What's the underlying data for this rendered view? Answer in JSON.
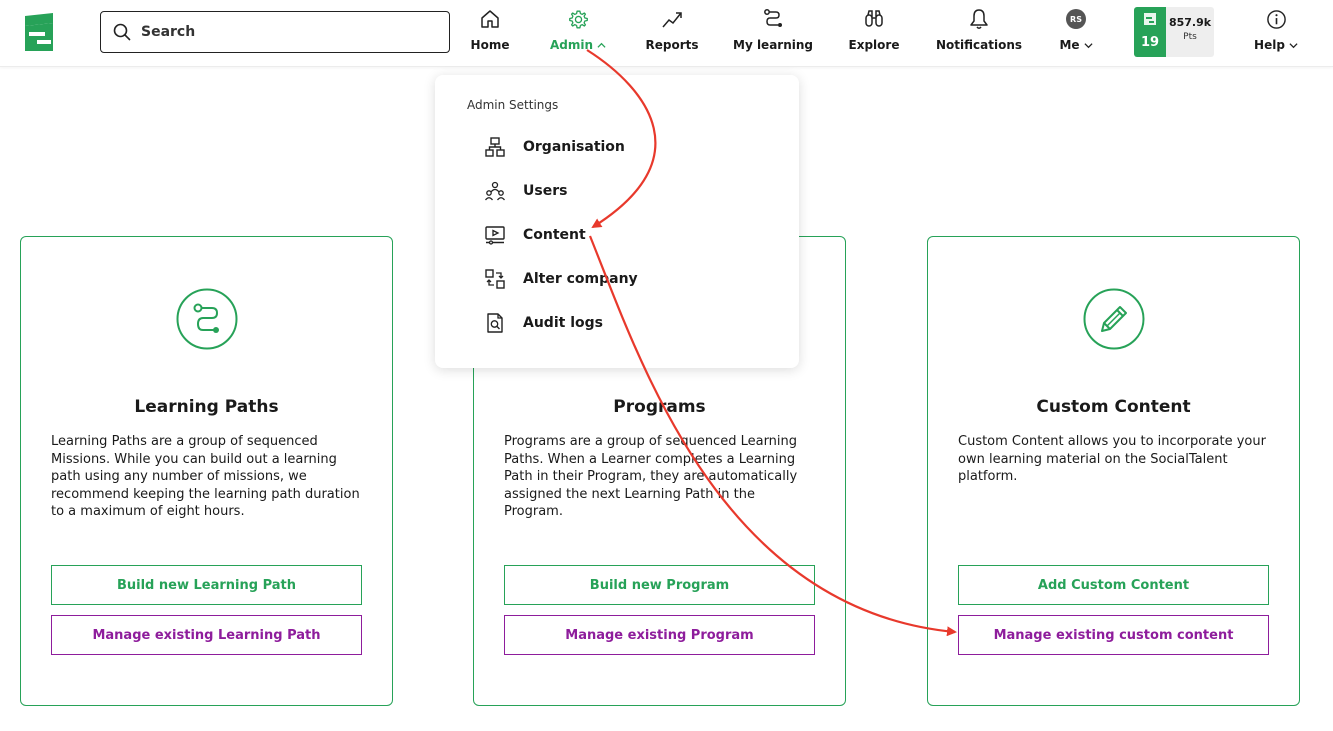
{
  "colors": {
    "brand_green": "#27a258",
    "manage_purple": "#8e1d9c",
    "annotation_red": "#e8392c"
  },
  "header": {
    "logo": "socialtalent-logo-icon",
    "search": {
      "placeholder": "Search"
    },
    "nav": [
      {
        "label": "Home",
        "icon": "home-icon"
      },
      {
        "label": "Admin",
        "icon": "gear-icon",
        "active": true
      },
      {
        "label": "Reports",
        "icon": "trend-up-icon"
      },
      {
        "label": "My learning",
        "icon": "learning-path-icon"
      },
      {
        "label": "Explore",
        "icon": "binoculars-icon"
      },
      {
        "label": "Notifications",
        "icon": "bell-icon"
      },
      {
        "label": "Me",
        "avatar_initials": "RS"
      },
      {
        "label": "Help",
        "icon": "info-icon"
      }
    ],
    "points": {
      "level": "19",
      "value": "857.9k",
      "unit": "Pts"
    }
  },
  "admin_menu": {
    "heading": "Admin Settings",
    "items": [
      {
        "label": "Organisation",
        "icon": "org-chart-icon"
      },
      {
        "label": "Users",
        "icon": "users-icon"
      },
      {
        "label": "Content",
        "icon": "content-player-icon"
      },
      {
        "label": "Alter company",
        "icon": "switch-company-icon"
      },
      {
        "label": "Audit logs",
        "icon": "audit-log-icon"
      }
    ]
  },
  "cards": [
    {
      "title": "Learning Paths",
      "icon": "learning-path-icon",
      "description": "Learning Paths are a group of sequenced Missions. While you can build out a learning path using any number of missions, we recommend keeping the learning path duration to a maximum of eight hours.",
      "primary_button": "Build new Learning Path",
      "secondary_button": "Manage existing Learning Path"
    },
    {
      "title": "Programs",
      "icon": "programs-icon",
      "description": "Programs are a group of sequenced Learning Paths. When a Learner completes a Learning Path in their Program, they are automatically assigned the next Learning Path in the Program.",
      "primary_button": "Build new Program",
      "secondary_button": "Manage existing Program"
    },
    {
      "title": "Custom Content",
      "icon": "pencil-icon",
      "description": "Custom Content allows you to incorporate your own learning material on the SocialTalent platform.",
      "primary_button": "Add Custom Content",
      "secondary_button": "Manage existing custom content"
    }
  ]
}
